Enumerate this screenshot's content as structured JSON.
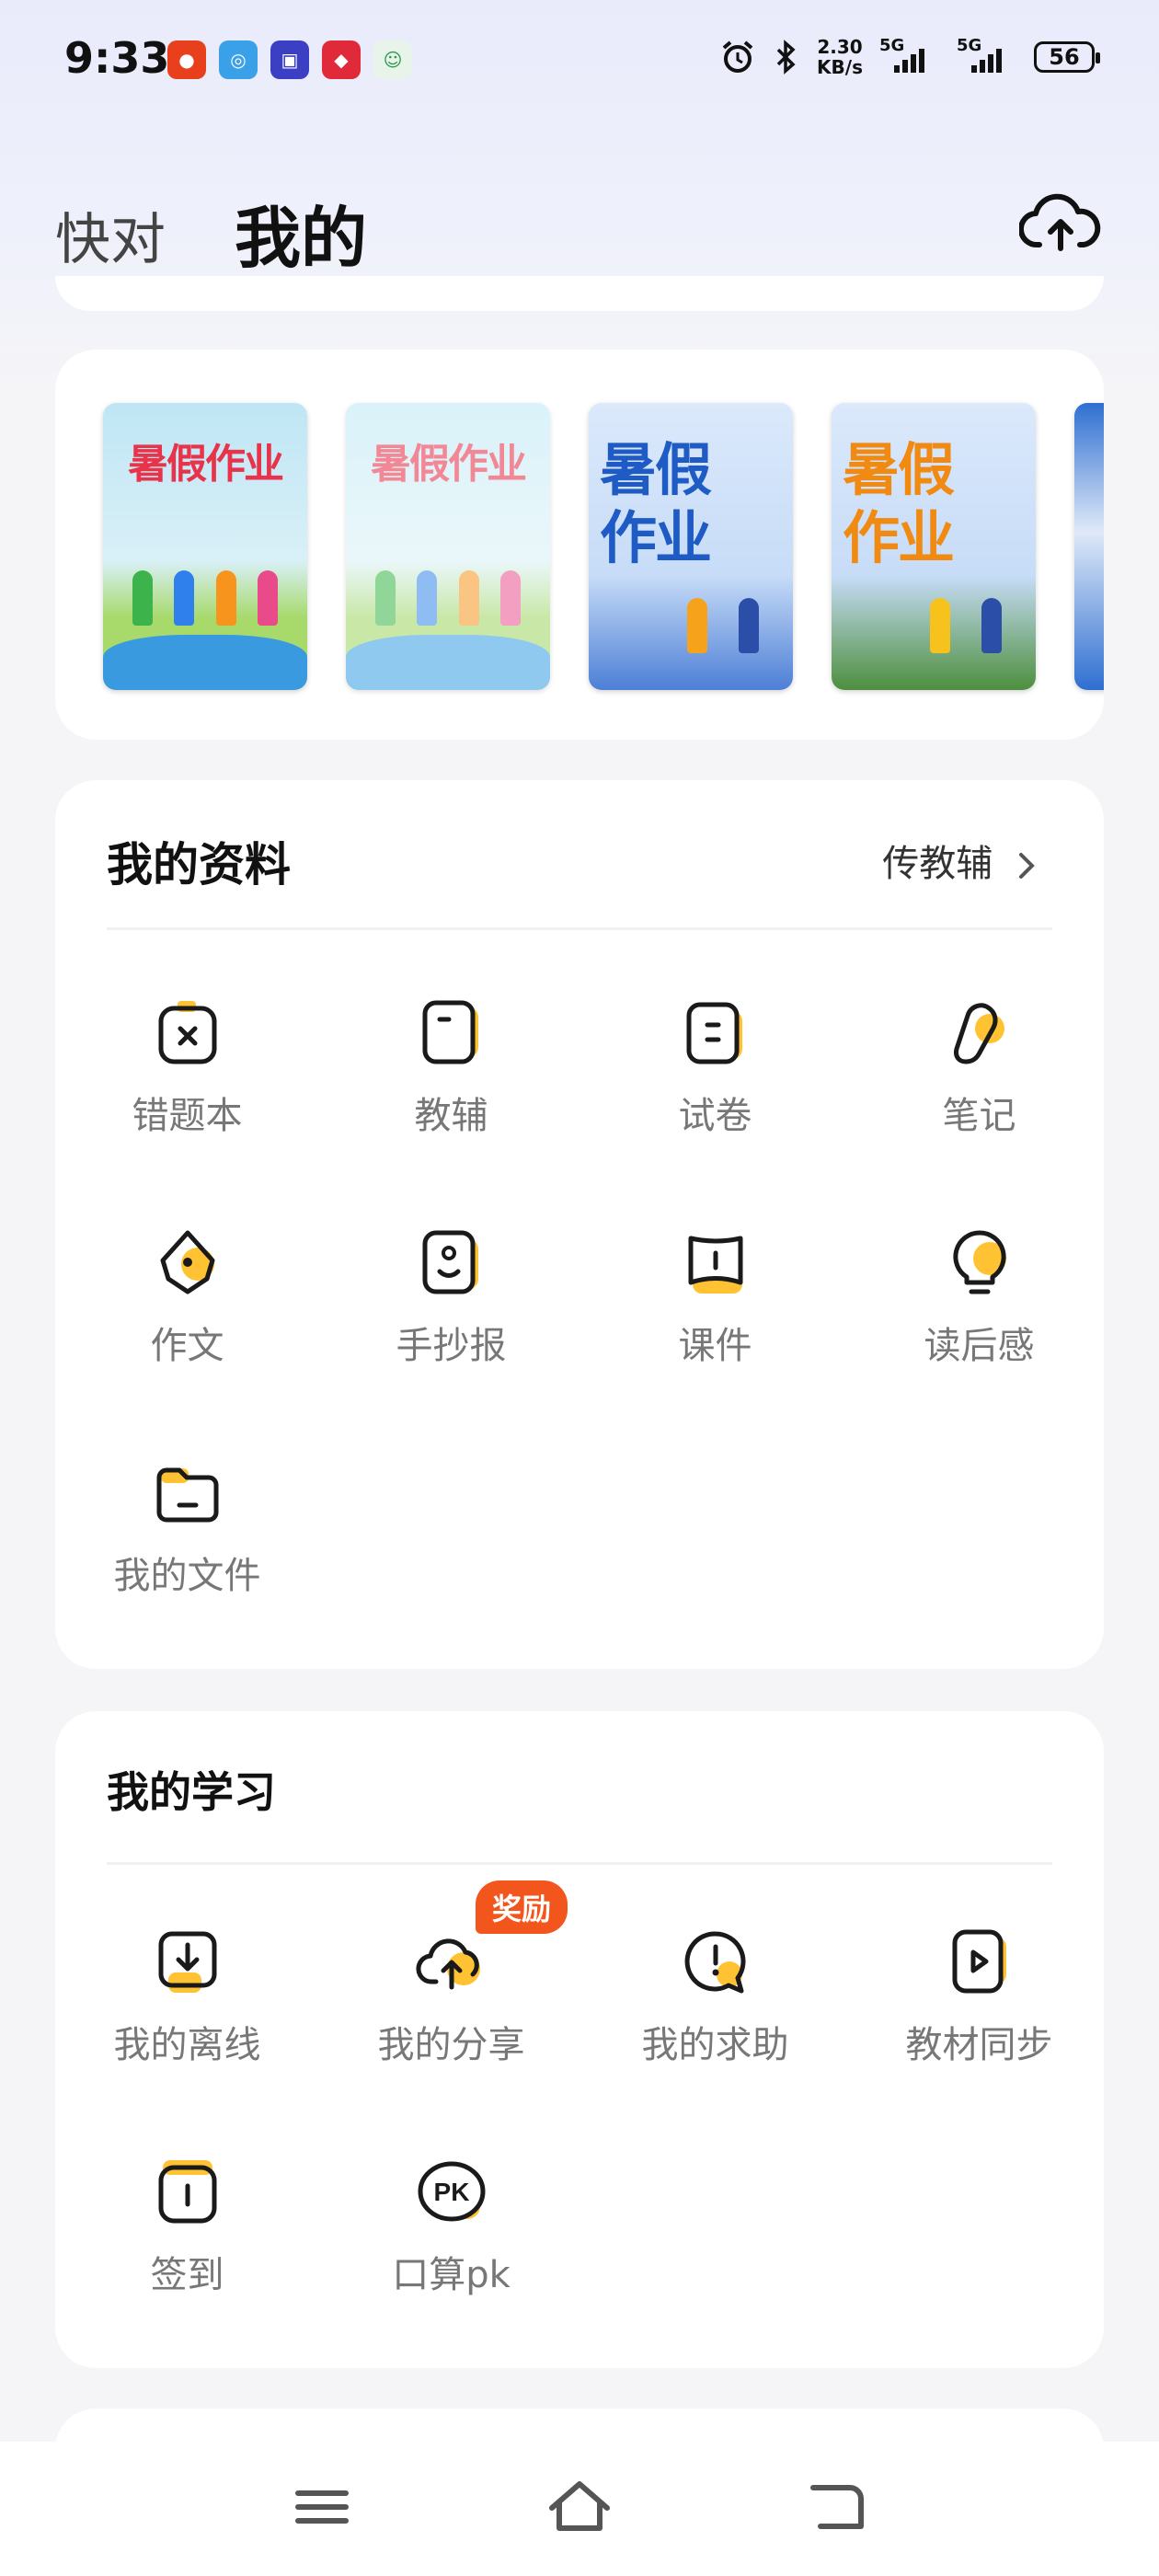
{
  "status_bar": {
    "time": "9:33",
    "net_speed_value": "2.30",
    "net_speed_unit": "KB/s",
    "sim1_label": "5G",
    "sim2_label": "5G",
    "battery": "56"
  },
  "header": {
    "tab_inactive": "快对",
    "tab_active": "我的"
  },
  "books": [
    {
      "title": "暑假作业",
      "style": "cartoon"
    },
    {
      "title": "暑假作业",
      "style": "cartoon-faded"
    },
    {
      "title_line1": "暑假",
      "title_line2": "作业",
      "style": "blue"
    },
    {
      "title_line1": "暑假",
      "title_line2": "作业",
      "style": "orange"
    }
  ],
  "materials": {
    "title": "我的资料",
    "link": "传教辅",
    "items": [
      {
        "label": "错题本",
        "icon": "mistake-book-icon"
      },
      {
        "label": "教辅",
        "icon": "textbook-icon"
      },
      {
        "label": "试卷",
        "icon": "exam-paper-icon"
      },
      {
        "label": "笔记",
        "icon": "note-pencil-icon"
      },
      {
        "label": "作文",
        "icon": "pen-nib-icon"
      },
      {
        "label": "手抄报",
        "icon": "newspaper-icon"
      },
      {
        "label": "课件",
        "icon": "courseware-icon"
      },
      {
        "label": "读后感",
        "icon": "lightbulb-icon"
      },
      {
        "label": "我的文件",
        "icon": "folder-icon"
      }
    ]
  },
  "learning": {
    "title": "我的学习",
    "badge": "奖励",
    "items": [
      {
        "label": "我的离线",
        "icon": "download-icon"
      },
      {
        "label": "我的分享",
        "icon": "cloud-upload-icon"
      },
      {
        "label": "我的求助",
        "icon": "help-bubble-icon"
      },
      {
        "label": "教材同步",
        "icon": "play-book-icon"
      },
      {
        "label": "签到",
        "icon": "calendar-checkin-icon"
      },
      {
        "label": "口算pk",
        "icon": "pk-icon"
      }
    ]
  },
  "colors": {
    "accent": "#FFC233",
    "badge": "#F2561D",
    "icon_stroke": "#1A1A1A"
  }
}
